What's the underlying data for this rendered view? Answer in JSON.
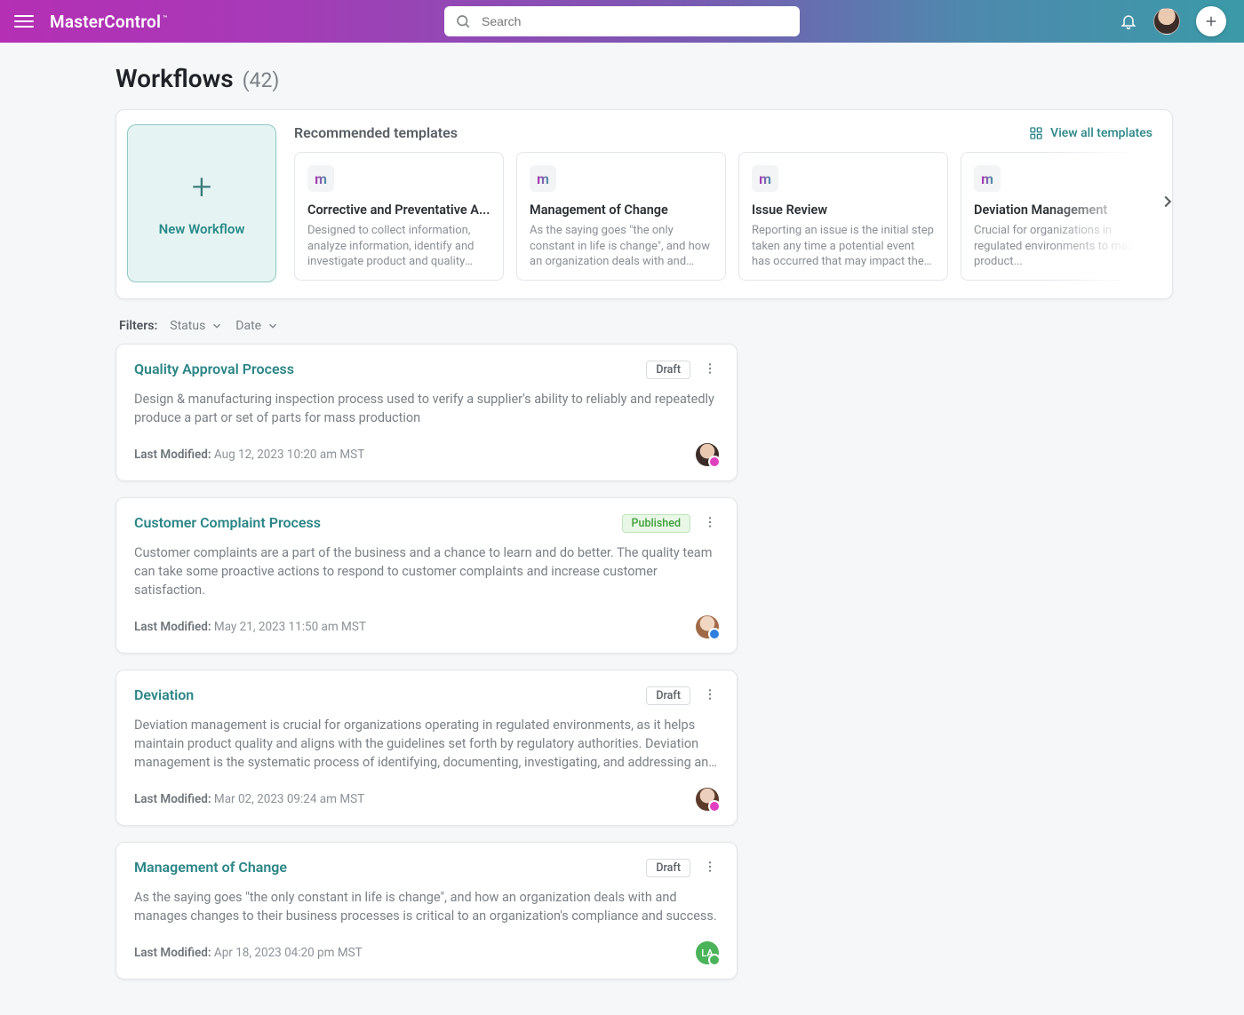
{
  "header": {
    "brand": "MasterControl",
    "search_placeholder": "Search"
  },
  "page": {
    "title": "Workflows",
    "count": "(42)"
  },
  "recommended": {
    "new_workflow_label": "New Workflow",
    "heading": "Recommended templates",
    "view_all_label": "View all templates",
    "templates": [
      {
        "title": "Corrective and Preventative A...",
        "desc": "Designed to collect information, analyze information, identify and investigate product and quality prob..."
      },
      {
        "title": "Management of Change",
        "desc": "As the saying goes \"the only constant in life is change\", and how an organization deals with and manage..."
      },
      {
        "title": "Issue Review",
        "desc": "Reporting an issue is the initial step taken any time a potential event has occurred that may impact the qualit..."
      },
      {
        "title": "Deviation Management",
        "desc": "Crucial for organizations in regulated environments to maintain product..."
      }
    ]
  },
  "filters": {
    "label": "Filters:",
    "chips": [
      {
        "label": "Status"
      },
      {
        "label": "Date"
      }
    ]
  },
  "workflows": [
    {
      "title": "Quality Approval Process",
      "status": "Draft",
      "status_kind": "draft",
      "desc": "Design & manufacturing inspection process used to verify a supplier's ability to reliably and repeatedly produce a part or set of parts for mass production",
      "modified_label": "Last Modified:",
      "modified_value": "Aug 12, 2023 10:20 am MST",
      "owner_class": "owner-a",
      "bolt": "pink"
    },
    {
      "title": "Customer Complaint Process",
      "status": "Published",
      "status_kind": "published",
      "desc": "Customer complaints are a part of the business and a chance to learn and do better. The quality team can take some proactive actions to respond to customer complaints and increase customer satisfaction.",
      "modified_label": "Last Modified:",
      "modified_value": "May 21, 2023 11:50 am MST",
      "owner_class": "owner-b",
      "bolt": "blue"
    },
    {
      "title": "Deviation",
      "status": "Draft",
      "status_kind": "draft",
      "desc": "Deviation management is crucial for organizations operating in regulated environments, as it helps maintain product quality and aligns with the guidelines set forth by regulatory authorities. Deviation management is the systematic process of identifying, documenting, investigating, and addressing any unexpected or unplanned...",
      "modified_label": "Last Modified:",
      "modified_value": "Mar 02, 2023 09:24 am MST",
      "owner_class": "owner-c",
      "bolt": "pink"
    },
    {
      "title": "Management of Change",
      "status": "Draft",
      "status_kind": "draft",
      "desc": "As the saying goes \"the only constant in life is change\", and how an organization deals with and manages changes to their business processes is critical to an organization's compliance and success.",
      "modified_label": "Last Modified:",
      "modified_value": "Apr 18, 2023 04:20 pm MST",
      "owner_class": "green",
      "owner_initials": "LA",
      "bolt": "green"
    }
  ]
}
